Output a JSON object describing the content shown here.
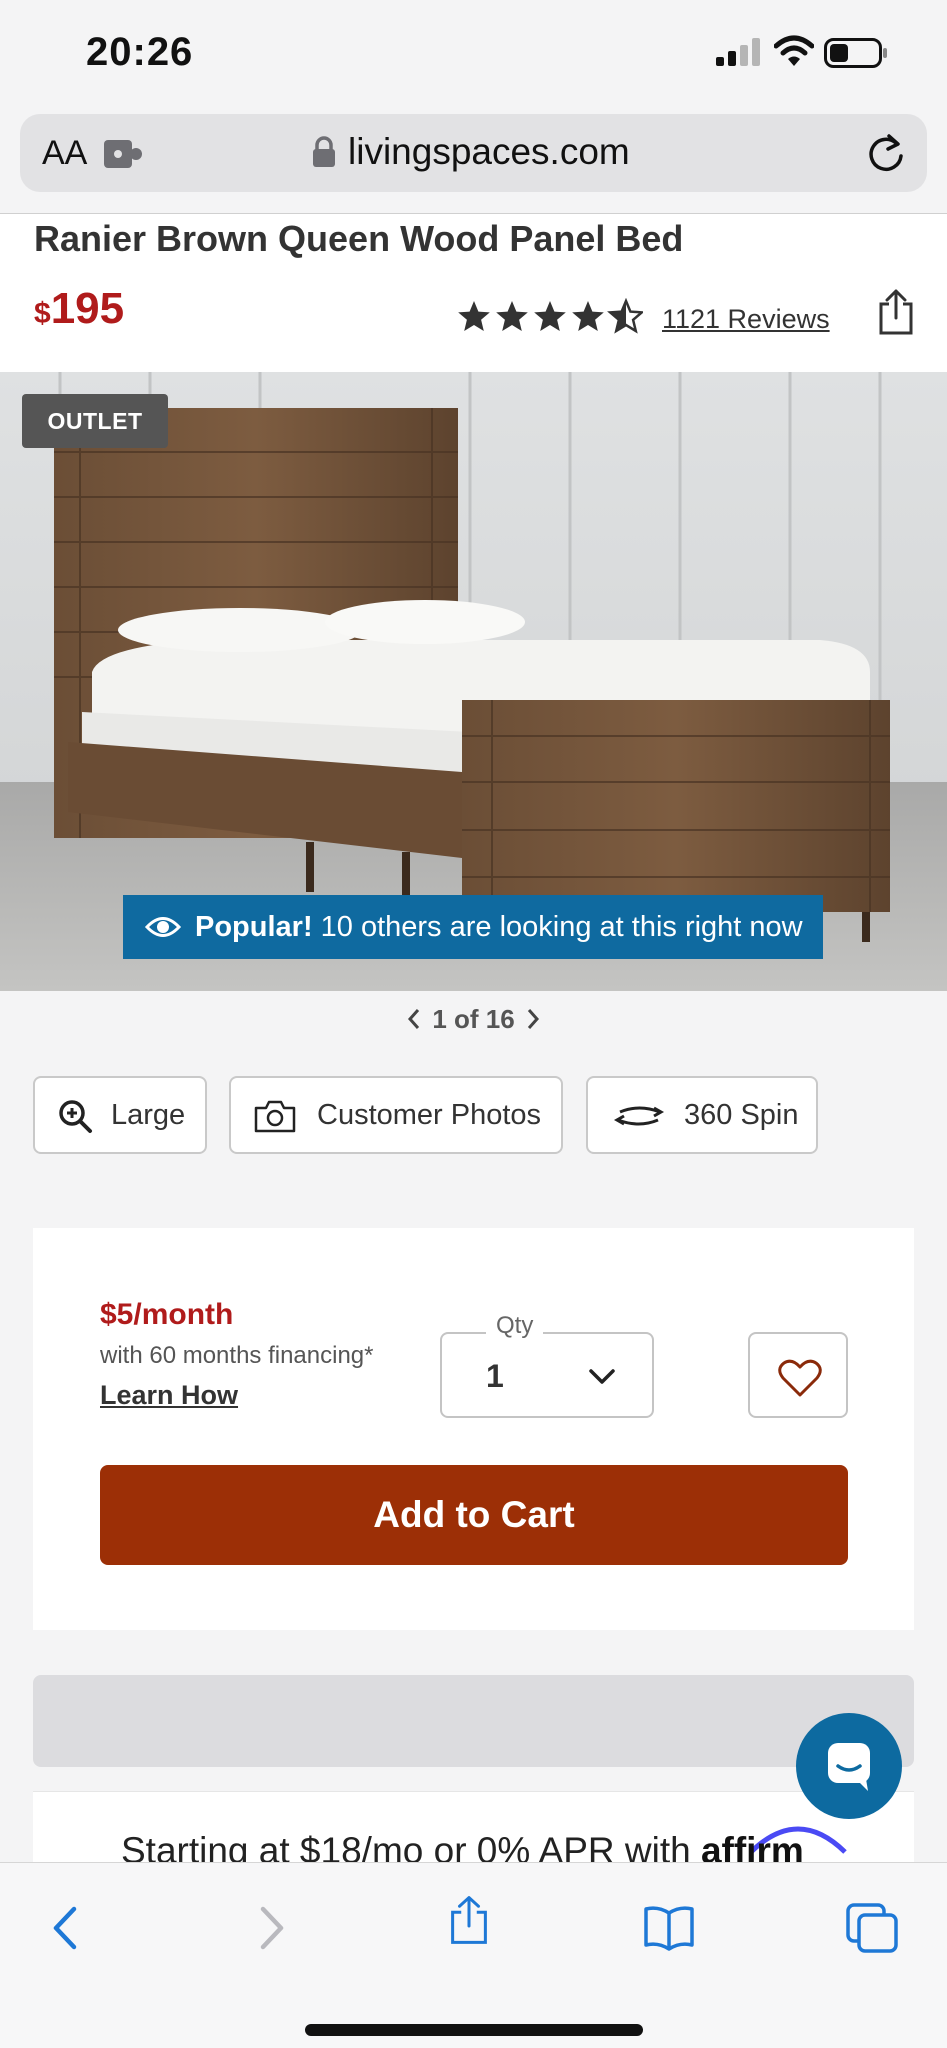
{
  "status_bar": {
    "time": "20:26"
  },
  "browser": {
    "text_size_label": "AA",
    "domain": "livingspaces.com"
  },
  "product": {
    "title": "Ranier Brown Queen Wood Panel Bed",
    "price_currency": "$",
    "price_amount": "195",
    "rating": 4.5,
    "reviews_label": "1121 Reviews",
    "badge": "OUTLET",
    "popular_strong": "Popular!",
    "popular_text": "10 others are looking at this right now",
    "pager": {
      "current": 1,
      "total": 16,
      "label": "1 of 16"
    }
  },
  "media_buttons": {
    "large": "Large",
    "photos": "Customer Photos",
    "spin": "360 Spin"
  },
  "purchase": {
    "monthly": "$5/month",
    "financing": "with 60 months financing*",
    "learn_how": "Learn How",
    "qty_label": "Qty",
    "qty_value": "1",
    "add_to_cart": "Add to Cart"
  },
  "affirm": {
    "text": "Starting at $18/mo or 0% APR with",
    "brand": "affirm"
  },
  "colors": {
    "price_red": "#b01b1b",
    "cart_button": "#9c2f06",
    "popular_banner": "#0f6aa0",
    "browser_blue": "#1e78d6"
  },
  "icons": [
    "signal-icon",
    "wifi-icon",
    "battery-icon",
    "extension-icon",
    "lock-icon",
    "reload-icon",
    "star-icon",
    "share-icon",
    "eye-icon",
    "chevron-left-icon",
    "chevron-right-icon",
    "zoom-in-icon",
    "camera-icon",
    "spin-icon",
    "chevron-down-icon",
    "heart-icon",
    "chat-icon",
    "back-icon",
    "forward-icon",
    "bookmarks-icon",
    "tabs-icon"
  ]
}
